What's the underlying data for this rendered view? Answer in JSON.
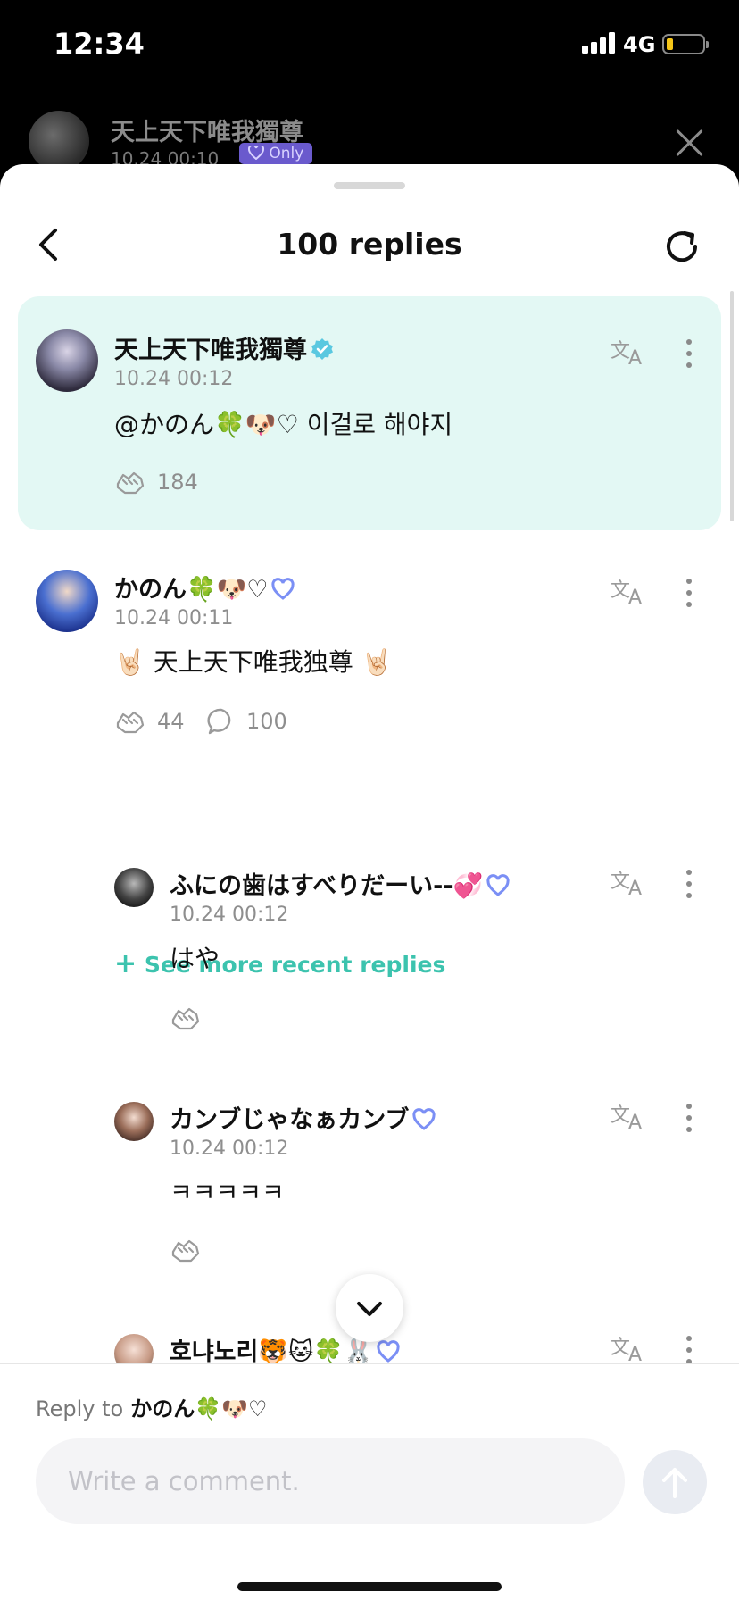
{
  "status_bar": {
    "time": "12:34",
    "network": "4G"
  },
  "post_header": {
    "author": "天上天下唯我獨尊",
    "date": "10.24 00:10",
    "badge": "Only"
  },
  "sheet": {
    "title": "100 replies"
  },
  "comments": [
    {
      "author": "天上天下唯我獨尊",
      "date": "10.24 00:12",
      "text": "@かのん🍀🐶♡ 이걸로 해야지",
      "likes": "184",
      "highlighted": true
    },
    {
      "author": "かのん🍀🐶♡",
      "date": "10.24 00:11",
      "text": "🤘🏻 天上天下唯我独尊 🤘🏻",
      "likes": "44",
      "replies": "100"
    }
  ],
  "see_more_label": "See more recent replies",
  "replies": [
    {
      "author": "ふにの歯はすべりだーい--💞",
      "date": "10.24 00:12",
      "text": "はや"
    },
    {
      "author": "カンブじゃなぁカンブ",
      "date": "10.24 00:12",
      "text": "ㅋㅋㅋㅋㅋ"
    },
    {
      "author": "호냐노리🐯🐱🍀🐰"
    }
  ],
  "composer": {
    "reply_to_label": "Reply to",
    "reply_to_name": "かのん🍀🐶♡",
    "placeholder": "Write a comment."
  },
  "colors": {
    "accent": "#3cc3ae",
    "highlight_bg": "#e3f8f4",
    "verified": "#5ac8e0"
  },
  "icons": [
    "back-chevron-icon",
    "refresh-icon",
    "translate-icon",
    "more-vertical-icon",
    "cheer-icon",
    "comment-bubble-icon",
    "plus-icon",
    "chevron-down-icon",
    "arrow-up-icon",
    "close-icon"
  ]
}
